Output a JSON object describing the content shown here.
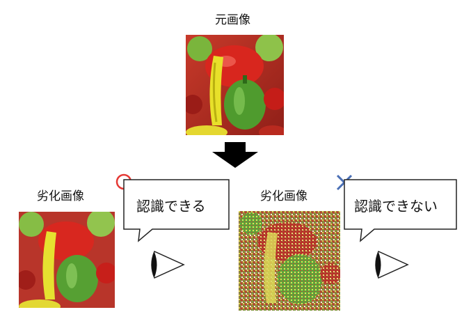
{
  "original": {
    "title": "元画像"
  },
  "degraded_left": {
    "title": "劣化画像",
    "mark": "circle",
    "mark_color": "#e53935",
    "bubble_text": "認識できる"
  },
  "degraded_right": {
    "title": "劣化画像",
    "mark": "cross",
    "mark_color": "#4a6fb5",
    "bubble_text": "認識できない"
  },
  "arrow": {
    "direction": "down",
    "color": "#000000"
  },
  "eye_icon": "eye-icon",
  "image_subject": "peppers"
}
